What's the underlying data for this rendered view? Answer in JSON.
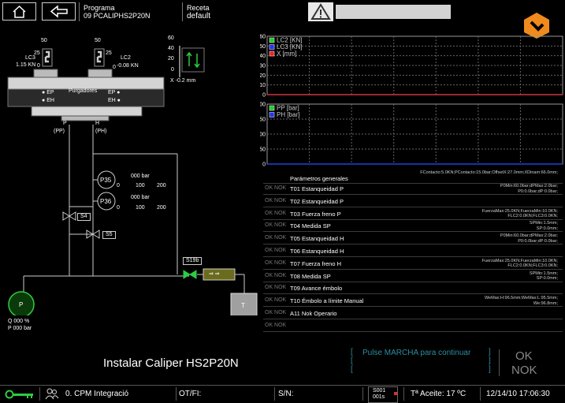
{
  "header": {
    "home_icon": "home-icon",
    "back_icon": "back-arrow-icon",
    "programa_label": "Programa",
    "programa_value": "09  PCALIPHS2P20N",
    "receta_label": "Receta",
    "receta_value": "default",
    "warning_icon": "warning-icon"
  },
  "diagram": {
    "lc3_label": "LC3",
    "lc3_value": "1.15 KN",
    "lc2_label": "LC2",
    "lc2_value": "-0.08 KN",
    "lc3_scale_top": "50",
    "lc3_scale_mid": "25",
    "lc3_scale_bot": "0",
    "lc2_scale_top": "50",
    "lc2_scale_mid": "25",
    "lc2_scale_bot": "0",
    "x_scale": [
      "60",
      "40",
      "20",
      "0"
    ],
    "x_value": "X -0.2 mm",
    "purgadores": "Purgadores",
    "ep_left": "EP",
    "eh_left": "EH",
    "ep_right": "EP",
    "eh_right": "EH",
    "p_label": "P",
    "pp_label": "(PP)",
    "h_label": "H",
    "ph_label": "(PH)",
    "p35": "P35",
    "p35_value": "000 bar",
    "p35_ticks": [
      "0",
      "100",
      "200"
    ],
    "p36": "P36",
    "p36_value": "000 bar",
    "p36_ticks": [
      "0",
      "100",
      "200"
    ],
    "s4": "S4",
    "s5": "S5",
    "s19b": "S19b",
    "pump": "P",
    "pump_q": "Q 000 %",
    "pump_p": "P 000 bar",
    "tank": "T"
  },
  "chart_data": [
    {
      "type": "line",
      "ylim": [
        0,
        60
      ],
      "yticks": [
        "60",
        "50",
        "40",
        "30",
        "20",
        "10",
        "0"
      ],
      "series": [
        {
          "name": "LC2 [KN]",
          "color": "#22cc22",
          "values": [
            0,
            0
          ]
        },
        {
          "name": "LC3 [KN]",
          "color": "#2233ff",
          "values": [
            0,
            0
          ]
        },
        {
          "name": "X [mm]",
          "color": "#ee2222",
          "values": [
            0,
            0
          ]
        }
      ],
      "grid": true
    },
    {
      "type": "line",
      "ylim": [
        0,
        200
      ],
      "yticks": [
        "200",
        "150",
        "100",
        "50",
        "0"
      ],
      "series": [
        {
          "name": "PP [bar]",
          "color": "#22cc22",
          "values": [
            0,
            0
          ]
        },
        {
          "name": "PH [bar]",
          "color": "#2233ff",
          "values": [
            0,
            0
          ]
        }
      ],
      "grid": true
    }
  ],
  "tests": {
    "header_label": "Parámetros generales",
    "header_params": "FContacto:5.0KN;PContacto:15.0bar;OffsetX:27.0mm;XDinam:66.0mm;",
    "rows": [
      {
        "ok": "OK NOK",
        "name": "T01 Estanqueidad P",
        "params": "P0Min:60.0bar;dPMax:2.0bar;\nP0:0.0bar;dP:0.0bar;"
      },
      {
        "ok": "OK NOK",
        "name": "T02 Estanqueidad P",
        "params": ""
      },
      {
        "ok": "OK NOK",
        "name": "T03 Fuerza freno P",
        "params": "FuerzaMax:25.0KN;FuerzaMin:10.0KN;\nFLC2:0.0KN;FLC3:0.0KN;"
      },
      {
        "ok": "OK NOK",
        "name": "T04 Medida SP",
        "params": "SPMin:1.5mm;\nSP:0.0mm;"
      },
      {
        "ok": "OK NOK",
        "name": "T05 Estanqueidad H",
        "params": "P0Min:60.0bar;dPMax:2.0bar;\nP0:0.0bar;dP:0.0bar;"
      },
      {
        "ok": "OK NOK",
        "name": "T06 Estanqueidad H",
        "params": ""
      },
      {
        "ok": "OK NOK",
        "name": "T07 Fuerza freno H",
        "params": "FuerzaMax:25.0KN;FuerzaMin:10.0KN;\nFLC2:0.0KN;FLC3:0.0KN;"
      },
      {
        "ok": "OK NOK",
        "name": "T08 Medida SP",
        "params": "SPMin:1.5mm;\nSP:0.0mm;"
      },
      {
        "ok": "OK NOK",
        "name": "T09 Avance émbolo",
        "params": ""
      },
      {
        "ok": "OK NOK",
        "name": "T10 Émbolo a límite Manual",
        "params": "WeMax:H:96.5mm;WeMax:L:95.5mm;\nWe:96.8mm;"
      },
      {
        "ok": "OK NOK",
        "name": "A11 Nok Operario",
        "params": ""
      },
      {
        "ok": "OK NOK",
        "name": "",
        "params": ""
      }
    ]
  },
  "instruction": {
    "text": "Instalar Caliper HS2P20N",
    "prompt": "Pulse MARCHA para continuar",
    "result_ok": "OK",
    "result_nok": "NOK"
  },
  "status_bar": {
    "key_icon": "key-icon",
    "user_icon": "users-icon",
    "user": "0. CPM Integració",
    "otfi": "OT/FI:",
    "sn": "S/N:",
    "s001": "S001",
    "s001_sub": "001s",
    "aceite": "Tª Aceite: 17 ºC",
    "datetime": "12/14/10 17:06:30"
  }
}
